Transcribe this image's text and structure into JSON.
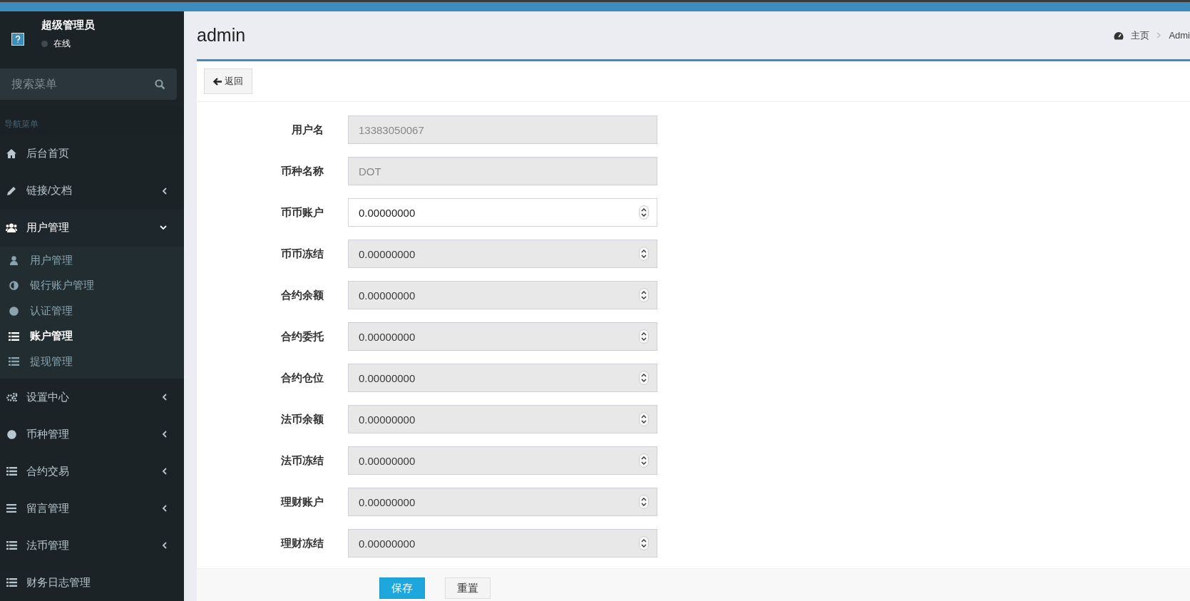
{
  "user_panel": {
    "name": "超级管理员",
    "status": "在线"
  },
  "search": {
    "placeholder": "搜索菜单"
  },
  "sidebar": {
    "header": "导航菜单",
    "items": [
      {
        "label": "后台首页",
        "kind": "link",
        "selected": false
      },
      {
        "label": "链接/文档",
        "kind": "group",
        "expanded": false,
        "selected": false
      },
      {
        "label": "用户管理",
        "kind": "group",
        "expanded": true,
        "selected": false,
        "children": [
          {
            "label": "用户管理",
            "selected": false
          },
          {
            "label": "银行账户管理",
            "selected": false
          },
          {
            "label": "认证管理",
            "selected": false
          },
          {
            "label": "账户管理",
            "selected": true
          },
          {
            "label": "提现管理",
            "selected": false
          }
        ]
      },
      {
        "label": "设置中心",
        "kind": "group",
        "expanded": false,
        "selected": false
      },
      {
        "label": "币种管理",
        "kind": "group",
        "expanded": false,
        "selected": false
      },
      {
        "label": "合约交易",
        "kind": "group",
        "expanded": false,
        "selected": false
      },
      {
        "label": "留言管理",
        "kind": "group",
        "expanded": false,
        "selected": false
      },
      {
        "label": "法币管理",
        "kind": "group",
        "expanded": false,
        "selected": false
      },
      {
        "label": "财务日志管理",
        "kind": "link",
        "selected": false
      }
    ]
  },
  "header": {
    "title": "admin",
    "breadcrumb": [
      "主页",
      "Admi"
    ]
  },
  "back_button": "返回",
  "form": {
    "fields": [
      {
        "label": "用户名",
        "value": "13383050067",
        "kind": "text",
        "disabled": true
      },
      {
        "label": "币种名称",
        "value": "DOT",
        "kind": "text",
        "disabled": true
      },
      {
        "label": "币币账户",
        "value": "0.00000000",
        "kind": "number",
        "disabled": false
      },
      {
        "label": "币币冻结",
        "value": "0.00000000",
        "kind": "number",
        "disabled": true
      },
      {
        "label": "合约余额",
        "value": "0.00000000",
        "kind": "number",
        "disabled": true
      },
      {
        "label": "合约委托",
        "value": "0.00000000",
        "kind": "number",
        "disabled": true
      },
      {
        "label": "合约仓位",
        "value": "0.00000000",
        "kind": "number",
        "disabled": true
      },
      {
        "label": "法币余额",
        "value": "0.00000000",
        "kind": "number",
        "disabled": true
      },
      {
        "label": "法币冻结",
        "value": "0.00000000",
        "kind": "number",
        "disabled": true
      },
      {
        "label": "理财账户",
        "value": "0.00000000",
        "kind": "number",
        "disabled": true
      },
      {
        "label": "理财冻结",
        "value": "0.00000000",
        "kind": "number",
        "disabled": true
      }
    ],
    "buttons": [
      {
        "label": "保存",
        "kind": "primary"
      },
      {
        "label": "重置",
        "kind": "default"
      }
    ]
  }
}
